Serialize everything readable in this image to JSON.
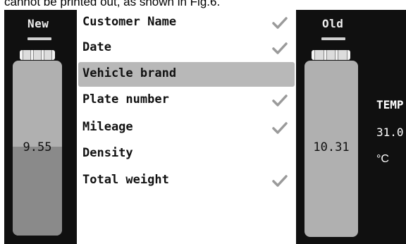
{
  "caption": "cannot be printed out, as shown in Fig.6.",
  "tanks": {
    "new": {
      "title": "New",
      "value": "9.55",
      "fill_level": 0.51
    },
    "old": {
      "title": "Old",
      "value": "10.31",
      "fill_level": 0.0
    }
  },
  "list": {
    "items": [
      {
        "label": "Customer Name",
        "checked": true,
        "selected": false
      },
      {
        "label": "Date",
        "checked": true,
        "selected": false
      },
      {
        "label": "Vehicle brand",
        "checked": false,
        "selected": true
      },
      {
        "label": "Plate number",
        "checked": true,
        "selected": false
      },
      {
        "label": "Mileage",
        "checked": true,
        "selected": false
      },
      {
        "label": "Density",
        "checked": false,
        "selected": false
      },
      {
        "label": "Total weight",
        "checked": true,
        "selected": false
      }
    ]
  },
  "temperature": {
    "label": "TEMP",
    "value": "31.0",
    "unit": "°C"
  },
  "colors": {
    "screen_bg": "#101010",
    "tank_body": "#b0b0b0",
    "tank_fill": "#8a8a8a",
    "selection": "#b8b8b8",
    "check": "#9a9a9a"
  },
  "icons": {
    "check": "check-icon"
  }
}
